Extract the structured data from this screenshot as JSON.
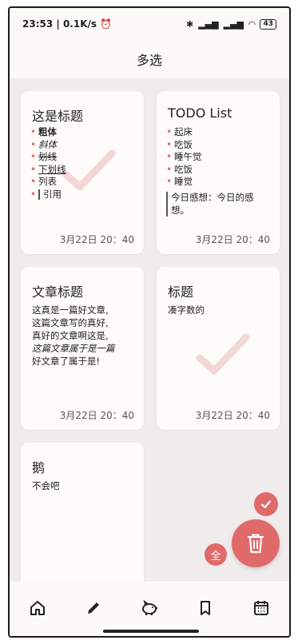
{
  "status": {
    "time": "23:53",
    "speed": "0.1K/s",
    "battery": "43"
  },
  "appbar": {
    "title": "多选"
  },
  "cards": [
    {
      "title": "这是标题",
      "items": [
        "粗体",
        "斜体",
        "划线",
        "下划线",
        "列表",
        "引用"
      ],
      "date": "3月22日 20：40"
    },
    {
      "title": "TODO List",
      "items": [
        "起床",
        "吃饭",
        "睡午觉",
        "吃饭",
        "睡觉"
      ],
      "thought_line1": "今日感想：今日的感",
      "thought_line2": "想。",
      "date": "3月22日 20：40"
    },
    {
      "title": "文章标题",
      "lines": [
        "这真是一篇好文章,",
        "这篇文章写的真好,",
        "真好的文章啊这是,",
        "这篇文章属于是一篇",
        "好文章了属于是!"
      ],
      "date": "3月22日 20：40"
    },
    {
      "title": "标题",
      "body": "凑字数的",
      "date": "3月22日 20：40"
    },
    {
      "title": "鹅",
      "body": "不会吧"
    }
  ],
  "fab": {
    "select_all_label": "全"
  },
  "nav": [
    "home-icon",
    "pencil-icon",
    "piggy-bank-icon",
    "bookmark-icon",
    "calendar-icon"
  ],
  "colors": {
    "accent": "#e06a6a",
    "background": "#efeceb",
    "card": "#fefcfa"
  }
}
